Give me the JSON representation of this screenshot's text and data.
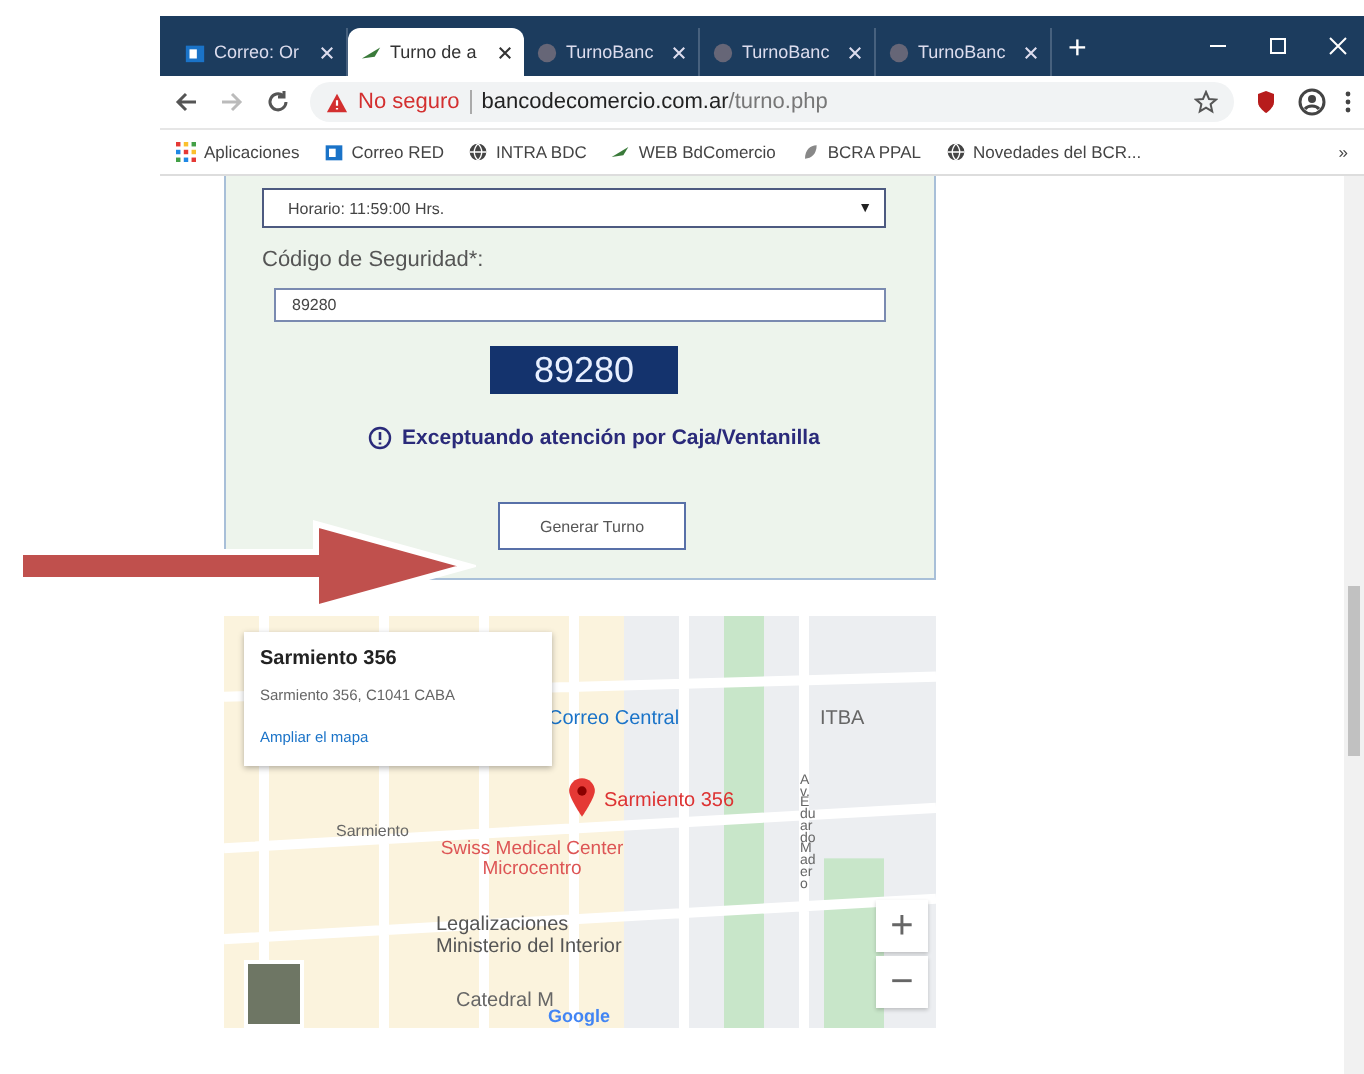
{
  "browser": {
    "tabs": [
      {
        "kind": "mail",
        "label": "Correo: Or",
        "selected": false
      },
      {
        "kind": "bank",
        "label": "Turno de a",
        "selected": true
      },
      {
        "kind": "globe",
        "label": "TurnoBanc",
        "selected": false
      },
      {
        "kind": "globe",
        "label": "TurnoBanc",
        "selected": false
      },
      {
        "kind": "globe",
        "label": "TurnoBanc",
        "selected": false
      }
    ],
    "new_tab": "+",
    "security_label": "No seguro",
    "url_host": "bancodecomercio.com.ar",
    "url_path": "/turno.php",
    "bookmarks": [
      {
        "kind": "apps",
        "label": "Aplicaciones"
      },
      {
        "kind": "mail",
        "label": "Correo RED"
      },
      {
        "kind": "globe",
        "label": "INTRA BDC"
      },
      {
        "kind": "bank",
        "label": "WEB BdComercio"
      },
      {
        "kind": "leaf",
        "label": "BCRA PPAL"
      },
      {
        "kind": "globe",
        "label": "Novedades del BCR..."
      }
    ],
    "more_bookmarks": "»"
  },
  "form": {
    "schedule_select": "Horario: 11:59:00 Hrs.",
    "select_caret": "▼",
    "security_label": "Código de Seguridad*:",
    "security_value": "89280",
    "captcha": "89280",
    "notice": "Exceptuando atención por Caja/Ventanilla",
    "submit": "Generar Turno"
  },
  "map": {
    "card_title": "Sarmiento 356",
    "card_address": "Sarmiento 356, C1041 CABA",
    "card_link": "Ampliar el mapa",
    "labels": [
      {
        "kind": "poi",
        "text": "Correo Central"
      },
      {
        "kind": "area",
        "text": "ITBA"
      },
      {
        "kind": "pin",
        "text": "Sarmiento 356"
      },
      {
        "kind": "street",
        "text": "Sarmiento"
      },
      {
        "kind": "hospital",
        "text": "Swiss Medical Center Microcentro"
      },
      {
        "kind": "poi",
        "text": "Legalizaciones Ministerio del Interior"
      },
      {
        "kind": "avenue",
        "text": "Av. Eduardo Madero"
      },
      {
        "kind": "area",
        "text": "Catedral M"
      }
    ],
    "zoom_in": "+",
    "zoom_out": "−",
    "logo": "Google"
  }
}
